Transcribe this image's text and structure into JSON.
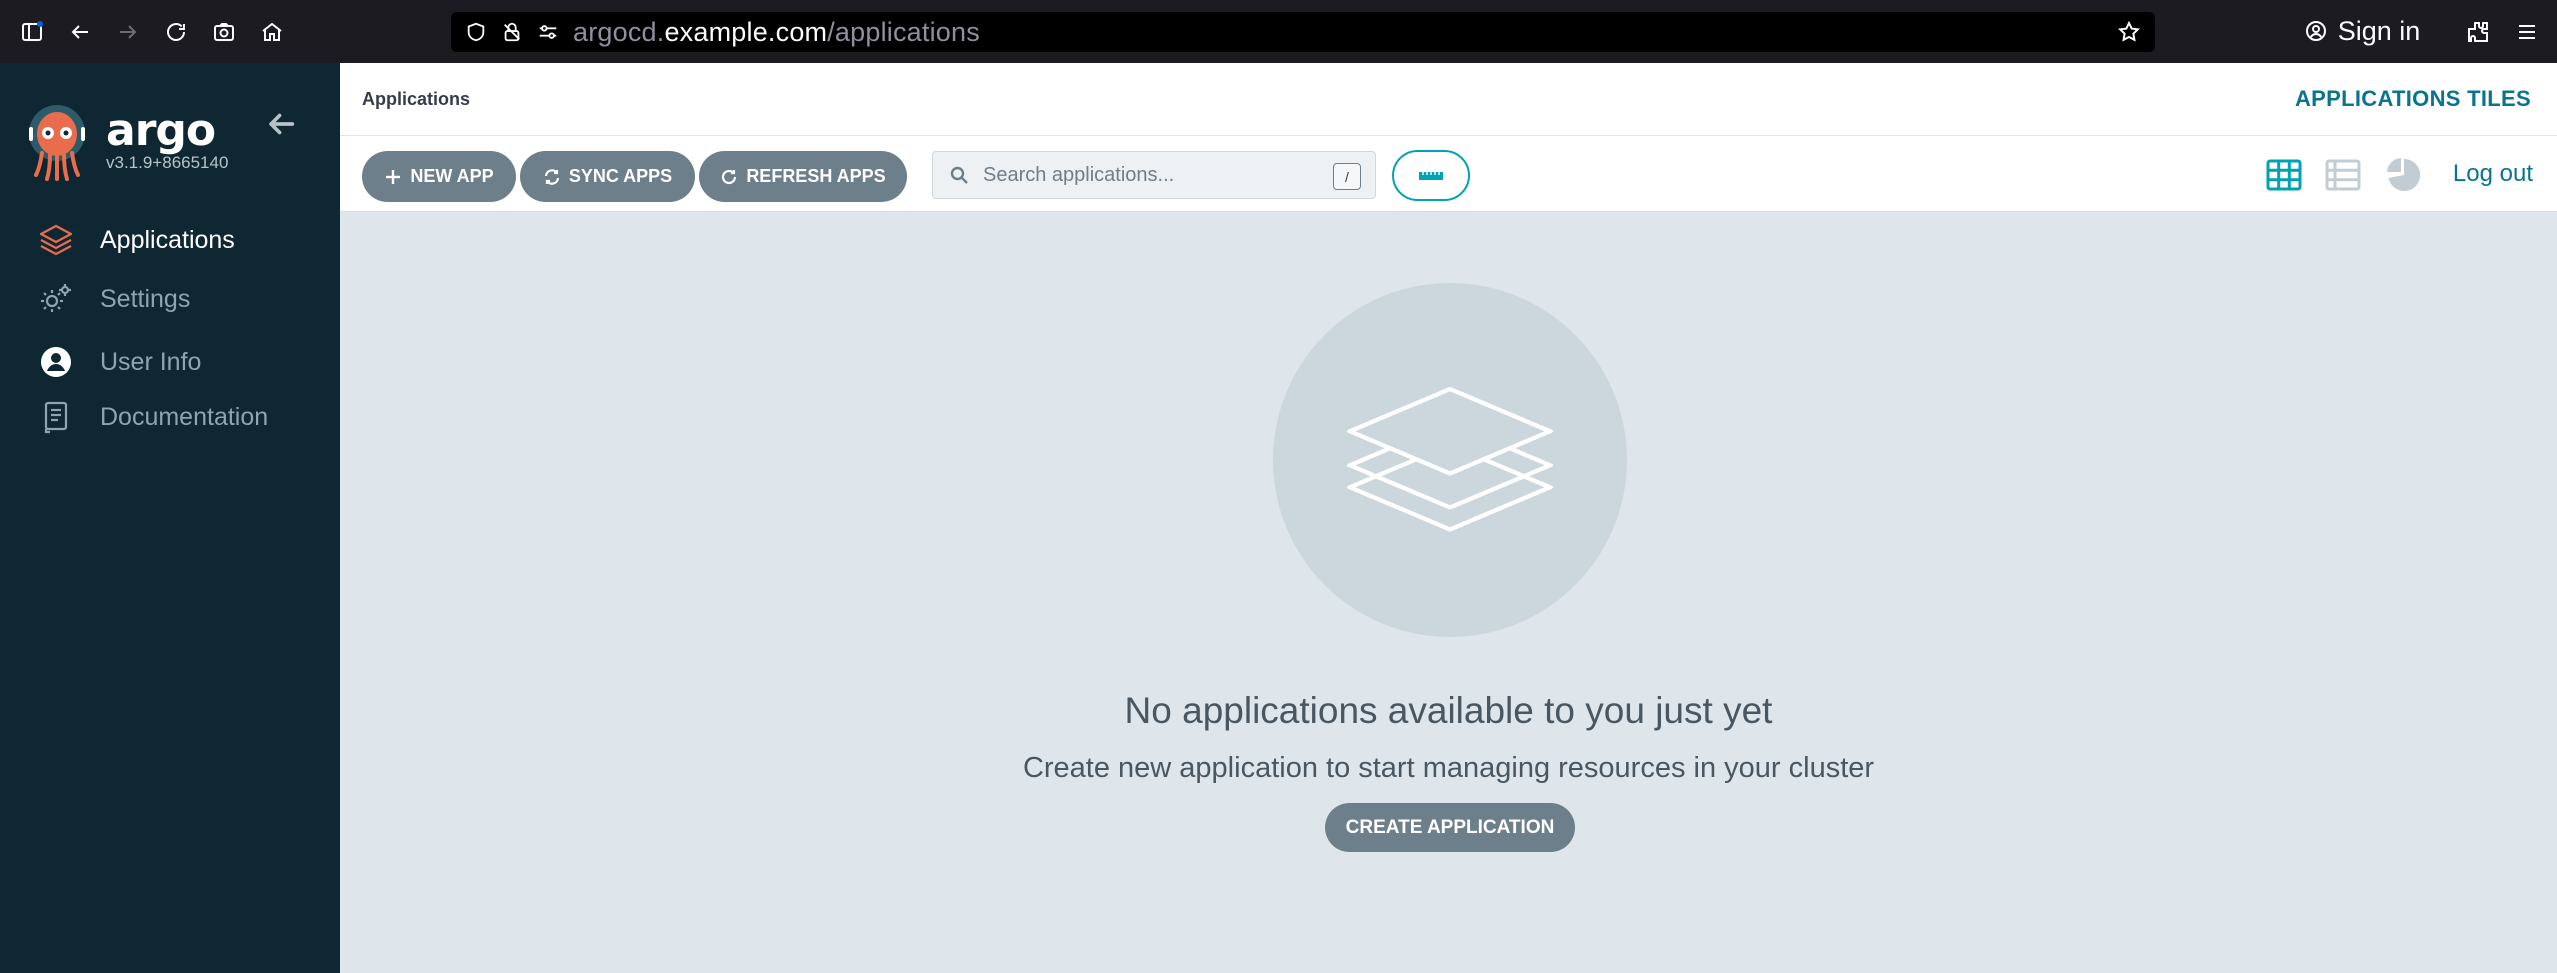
{
  "browser": {
    "url_prefix": "argocd.",
    "url_host": "example.com",
    "url_path": "/applications",
    "sign_in_label": "Sign in"
  },
  "sidebar": {
    "logo_title": "argo",
    "version": "v3.1.9+8665140",
    "items": [
      {
        "label": "Applications",
        "icon": "layers-icon",
        "active": true
      },
      {
        "label": "Settings",
        "icon": "gears-icon",
        "active": false
      },
      {
        "label": "User Info",
        "icon": "user-circle-icon",
        "active": false
      },
      {
        "label": "Documentation",
        "icon": "book-icon",
        "active": false
      }
    ]
  },
  "header": {
    "breadcrumb": "Applications",
    "view_title": "APPLICATIONS TILES"
  },
  "toolbar": {
    "new_app": "NEW APP",
    "sync_apps": "SYNC APPS",
    "refresh_apps": "REFRESH APPS",
    "search_placeholder": "Search applications...",
    "search_shortcut": "/",
    "logout": "Log out",
    "views": [
      "tiles-view-icon",
      "list-view-icon",
      "summary-pie-icon"
    ],
    "active_view": "tiles"
  },
  "empty_state": {
    "title": "No applications available to you just yet",
    "subtitle": "Create new application to start managing resources in your cluster",
    "button": "CREATE APPLICATION"
  },
  "colors": {
    "sidebar_bg": "#0f2733",
    "accent_teal": "#0a7490",
    "filter_accent": "#00a2b3",
    "button_gray": "#6d7f8b",
    "content_bg": "#dee6eb",
    "logo_orange": "#e96d4c"
  }
}
